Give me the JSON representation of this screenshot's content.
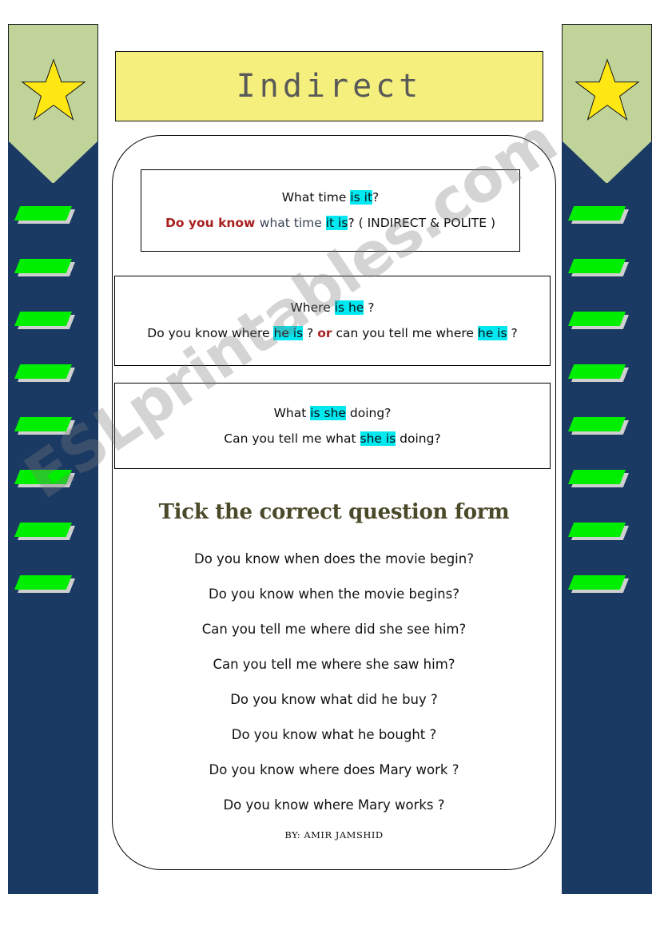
{
  "title": {
    "text": "Indirect"
  },
  "examples": [
    {
      "id": "example-time",
      "line1": [
        {
          "text": "What time ",
          "style": "plain"
        },
        {
          "text": "is it",
          "style": "highlight"
        },
        {
          "text": "?",
          "style": "plain"
        }
      ],
      "line2": [
        {
          "text": "Do you know ",
          "style": "red"
        },
        {
          "text": "what time ",
          "style": "navy"
        },
        {
          "text": "it is",
          "style": "highlight"
        },
        {
          "text": "? ( INDIRECT & POLITE )",
          "style": "plain"
        }
      ]
    },
    {
      "id": "example-where-he",
      "line1": [
        {
          "text": "Where ",
          "style": "plain"
        },
        {
          "text": "is he",
          "style": "highlight"
        },
        {
          "text": " ?",
          "style": "plain"
        }
      ],
      "line2": [
        {
          "text": "Do you know where ",
          "style": "plain"
        },
        {
          "text": "he is",
          "style": "highlight"
        },
        {
          "text": " ?  ",
          "style": "plain"
        },
        {
          "text": "or",
          "style": "red"
        },
        {
          "text": " can you tell me where ",
          "style": "plain"
        },
        {
          "text": "he is",
          "style": "highlight"
        },
        {
          "text": " ?",
          "style": "plain"
        }
      ]
    },
    {
      "id": "example-what-doing",
      "line1": [
        {
          "text": "What ",
          "style": "plain"
        },
        {
          "text": "is she",
          "style": "highlight"
        },
        {
          "text": " doing?",
          "style": "plain"
        }
      ],
      "line2": [
        {
          "text": "Can you tell me what ",
          "style": "plain"
        },
        {
          "text": "she is",
          "style": "highlight"
        },
        {
          "text": " doing?",
          "style": "plain"
        }
      ]
    }
  ],
  "exercise": {
    "heading": "Tick the correct question form",
    "questions": [
      "Do you know when does the movie begin?",
      "Do you know when the movie begins?",
      "Can you tell me where did she see him?",
      "Can you tell me where she saw him?",
      "Do you know what did he buy ?",
      "Do you know what he bought ?",
      "Do you know where does Mary work ?",
      "Do you know where Mary works ?"
    ]
  },
  "byline": "BY: AMIR JAMSHID",
  "watermark": "ESLprintables.com",
  "decor": {
    "star_icon": "star-icon",
    "parallelogram_count": 8,
    "colors": {
      "navy": "#1A3A63",
      "sage": "#C0D49A",
      "star_yellow": "#FFE713",
      "green": "#00EE00",
      "title_yellow": "#F5F07E",
      "highlight_cyan": "#00E8F0",
      "accent_red": "#A82020",
      "heading_olive": "#4A4A2A"
    }
  }
}
